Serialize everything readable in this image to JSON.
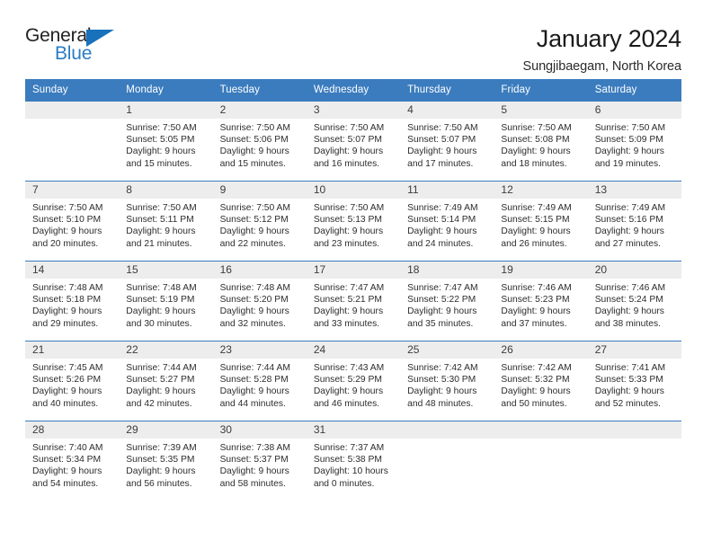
{
  "brand": {
    "name_top": "General",
    "name_bottom": "Blue",
    "triangle_color": "#1771bb",
    "accent_color": "#3b7cbe"
  },
  "header": {
    "title": "January 2024",
    "subtitle": "Sungjibaegam, North Korea"
  },
  "calendar": {
    "weekday_headers": [
      "Sunday",
      "Monday",
      "Tuesday",
      "Wednesday",
      "Thursday",
      "Friday",
      "Saturday"
    ],
    "labels": {
      "sunrise": "Sunrise:",
      "sunset": "Sunset:",
      "daylight": "Daylight:"
    },
    "weeks": [
      [
        {
          "day": "",
          "blank": true
        },
        {
          "day": "1",
          "sunrise": "Sunrise: 7:50 AM",
          "sunset": "Sunset: 5:05 PM",
          "daylight_line1": "Daylight: 9 hours",
          "daylight_line2": "and 15 minutes."
        },
        {
          "day": "2",
          "sunrise": "Sunrise: 7:50 AM",
          "sunset": "Sunset: 5:06 PM",
          "daylight_line1": "Daylight: 9 hours",
          "daylight_line2": "and 15 minutes."
        },
        {
          "day": "3",
          "sunrise": "Sunrise: 7:50 AM",
          "sunset": "Sunset: 5:07 PM",
          "daylight_line1": "Daylight: 9 hours",
          "daylight_line2": "and 16 minutes."
        },
        {
          "day": "4",
          "sunrise": "Sunrise: 7:50 AM",
          "sunset": "Sunset: 5:07 PM",
          "daylight_line1": "Daylight: 9 hours",
          "daylight_line2": "and 17 minutes."
        },
        {
          "day": "5",
          "sunrise": "Sunrise: 7:50 AM",
          "sunset": "Sunset: 5:08 PM",
          "daylight_line1": "Daylight: 9 hours",
          "daylight_line2": "and 18 minutes."
        },
        {
          "day": "6",
          "sunrise": "Sunrise: 7:50 AM",
          "sunset": "Sunset: 5:09 PM",
          "daylight_line1": "Daylight: 9 hours",
          "daylight_line2": "and 19 minutes."
        }
      ],
      [
        {
          "day": "7",
          "sunrise": "Sunrise: 7:50 AM",
          "sunset": "Sunset: 5:10 PM",
          "daylight_line1": "Daylight: 9 hours",
          "daylight_line2": "and 20 minutes."
        },
        {
          "day": "8",
          "sunrise": "Sunrise: 7:50 AM",
          "sunset": "Sunset: 5:11 PM",
          "daylight_line1": "Daylight: 9 hours",
          "daylight_line2": "and 21 minutes."
        },
        {
          "day": "9",
          "sunrise": "Sunrise: 7:50 AM",
          "sunset": "Sunset: 5:12 PM",
          "daylight_line1": "Daylight: 9 hours",
          "daylight_line2": "and 22 minutes."
        },
        {
          "day": "10",
          "sunrise": "Sunrise: 7:50 AM",
          "sunset": "Sunset: 5:13 PM",
          "daylight_line1": "Daylight: 9 hours",
          "daylight_line2": "and 23 minutes."
        },
        {
          "day": "11",
          "sunrise": "Sunrise: 7:49 AM",
          "sunset": "Sunset: 5:14 PM",
          "daylight_line1": "Daylight: 9 hours",
          "daylight_line2": "and 24 minutes."
        },
        {
          "day": "12",
          "sunrise": "Sunrise: 7:49 AM",
          "sunset": "Sunset: 5:15 PM",
          "daylight_line1": "Daylight: 9 hours",
          "daylight_line2": "and 26 minutes."
        },
        {
          "day": "13",
          "sunrise": "Sunrise: 7:49 AM",
          "sunset": "Sunset: 5:16 PM",
          "daylight_line1": "Daylight: 9 hours",
          "daylight_line2": "and 27 minutes."
        }
      ],
      [
        {
          "day": "14",
          "sunrise": "Sunrise: 7:48 AM",
          "sunset": "Sunset: 5:18 PM",
          "daylight_line1": "Daylight: 9 hours",
          "daylight_line2": "and 29 minutes."
        },
        {
          "day": "15",
          "sunrise": "Sunrise: 7:48 AM",
          "sunset": "Sunset: 5:19 PM",
          "daylight_line1": "Daylight: 9 hours",
          "daylight_line2": "and 30 minutes."
        },
        {
          "day": "16",
          "sunrise": "Sunrise: 7:48 AM",
          "sunset": "Sunset: 5:20 PM",
          "daylight_line1": "Daylight: 9 hours",
          "daylight_line2": "and 32 minutes."
        },
        {
          "day": "17",
          "sunrise": "Sunrise: 7:47 AM",
          "sunset": "Sunset: 5:21 PM",
          "daylight_line1": "Daylight: 9 hours",
          "daylight_line2": "and 33 minutes."
        },
        {
          "day": "18",
          "sunrise": "Sunrise: 7:47 AM",
          "sunset": "Sunset: 5:22 PM",
          "daylight_line1": "Daylight: 9 hours",
          "daylight_line2": "and 35 minutes."
        },
        {
          "day": "19",
          "sunrise": "Sunrise: 7:46 AM",
          "sunset": "Sunset: 5:23 PM",
          "daylight_line1": "Daylight: 9 hours",
          "daylight_line2": "and 37 minutes."
        },
        {
          "day": "20",
          "sunrise": "Sunrise: 7:46 AM",
          "sunset": "Sunset: 5:24 PM",
          "daylight_line1": "Daylight: 9 hours",
          "daylight_line2": "and 38 minutes."
        }
      ],
      [
        {
          "day": "21",
          "sunrise": "Sunrise: 7:45 AM",
          "sunset": "Sunset: 5:26 PM",
          "daylight_line1": "Daylight: 9 hours",
          "daylight_line2": "and 40 minutes."
        },
        {
          "day": "22",
          "sunrise": "Sunrise: 7:44 AM",
          "sunset": "Sunset: 5:27 PM",
          "daylight_line1": "Daylight: 9 hours",
          "daylight_line2": "and 42 minutes."
        },
        {
          "day": "23",
          "sunrise": "Sunrise: 7:44 AM",
          "sunset": "Sunset: 5:28 PM",
          "daylight_line1": "Daylight: 9 hours",
          "daylight_line2": "and 44 minutes."
        },
        {
          "day": "24",
          "sunrise": "Sunrise: 7:43 AM",
          "sunset": "Sunset: 5:29 PM",
          "daylight_line1": "Daylight: 9 hours",
          "daylight_line2": "and 46 minutes."
        },
        {
          "day": "25",
          "sunrise": "Sunrise: 7:42 AM",
          "sunset": "Sunset: 5:30 PM",
          "daylight_line1": "Daylight: 9 hours",
          "daylight_line2": "and 48 minutes."
        },
        {
          "day": "26",
          "sunrise": "Sunrise: 7:42 AM",
          "sunset": "Sunset: 5:32 PM",
          "daylight_line1": "Daylight: 9 hours",
          "daylight_line2": "and 50 minutes."
        },
        {
          "day": "27",
          "sunrise": "Sunrise: 7:41 AM",
          "sunset": "Sunset: 5:33 PM",
          "daylight_line1": "Daylight: 9 hours",
          "daylight_line2": "and 52 minutes."
        }
      ],
      [
        {
          "day": "28",
          "sunrise": "Sunrise: 7:40 AM",
          "sunset": "Sunset: 5:34 PM",
          "daylight_line1": "Daylight: 9 hours",
          "daylight_line2": "and 54 minutes."
        },
        {
          "day": "29",
          "sunrise": "Sunrise: 7:39 AM",
          "sunset": "Sunset: 5:35 PM",
          "daylight_line1": "Daylight: 9 hours",
          "daylight_line2": "and 56 minutes."
        },
        {
          "day": "30",
          "sunrise": "Sunrise: 7:38 AM",
          "sunset": "Sunset: 5:37 PM",
          "daylight_line1": "Daylight: 9 hours",
          "daylight_line2": "and 58 minutes."
        },
        {
          "day": "31",
          "sunrise": "Sunrise: 7:37 AM",
          "sunset": "Sunset: 5:38 PM",
          "daylight_line1": "Daylight: 10 hours",
          "daylight_line2": "and 0 minutes."
        },
        {
          "day": "",
          "blank": true
        },
        {
          "day": "",
          "blank": true
        },
        {
          "day": "",
          "blank": true
        }
      ]
    ]
  }
}
